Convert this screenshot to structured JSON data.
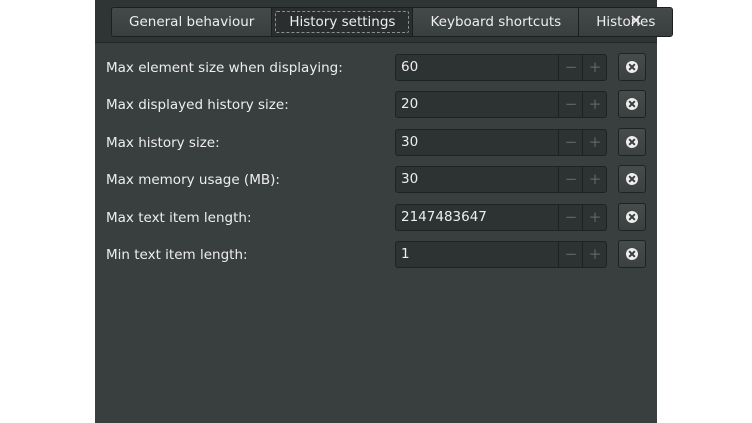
{
  "tabs": [
    {
      "label": "General behaviour",
      "active": false
    },
    {
      "label": "History settings",
      "active": true
    },
    {
      "label": "Keyboard shortcuts",
      "active": false
    },
    {
      "label": "Histories",
      "active": false
    }
  ],
  "close_label": "✕",
  "settings": [
    {
      "label": "Max element size when displaying:",
      "value": "60"
    },
    {
      "label": "Max displayed history size:",
      "value": "20"
    },
    {
      "label": "Max history size:",
      "value": "30"
    },
    {
      "label": "Max memory usage (MB):",
      "value": "30"
    },
    {
      "label": "Max text item length:",
      "value": "2147483647"
    },
    {
      "label": "Min text item length:",
      "value": "1"
    }
  ],
  "spin": {
    "minus": "−",
    "plus": "+"
  },
  "colors": {
    "window_bg": "#393f3f",
    "headerbar_bg": "#2f3434",
    "text": "#eeeeec"
  }
}
